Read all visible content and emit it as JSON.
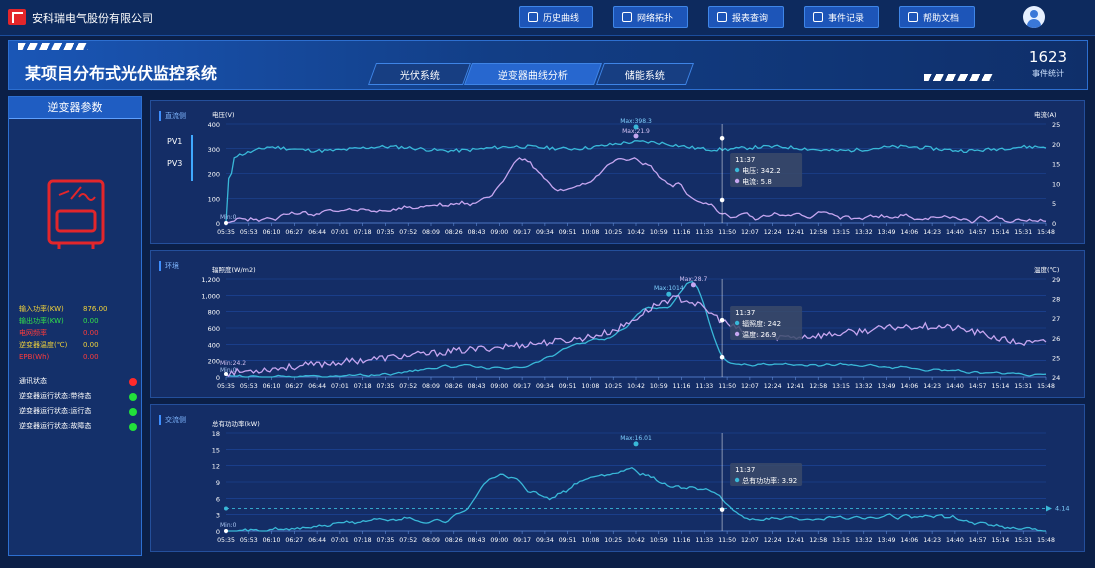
{
  "company": "安科瑞电气股份有限公司",
  "nav": [
    {
      "label": "历史曲线",
      "icon": "history-icon"
    },
    {
      "label": "网络拓扑",
      "icon": "topology-icon"
    },
    {
      "label": "报表查询",
      "icon": "search-icon"
    },
    {
      "label": "事件记录",
      "icon": "event-icon"
    },
    {
      "label": "帮助文档",
      "icon": "help-icon"
    }
  ],
  "title": "某项目分布式光伏监控系统",
  "tabs": [
    "光伏系统",
    "逆变器曲线分析",
    "储能系统"
  ],
  "event_count": "1623",
  "event_label": "事件统计",
  "left": {
    "header": "逆变器参数",
    "params": [
      {
        "k": "输入功率(KW)",
        "v": "876.00",
        "color": "#f2d33a"
      },
      {
        "k": "输出功率(KW)",
        "v": "0.00",
        "color": "#33e04a"
      },
      {
        "k": "电网频率",
        "v": "0.00",
        "color": "#ff3b3b"
      },
      {
        "k": "逆变器温度(℃)",
        "v": "0.00",
        "color": "#f2d33a"
      },
      {
        "k": "EPB(Wh)",
        "v": "0.00",
        "color": "#ff3b3b"
      }
    ],
    "status": [
      {
        "k": "通讯状态",
        "color": "#ff2a2a"
      },
      {
        "k": "逆变器运行状态:带待态",
        "color": "#22e03a"
      },
      {
        "k": "逆变器运行状态:运行态",
        "color": "#22e03a"
      },
      {
        "k": "逆变器运行状态:故障态",
        "color": "#22e03a"
      }
    ]
  },
  "time_labels": [
    "05:35",
    "05:53",
    "06:10",
    "06:27",
    "06:44",
    "07:01",
    "07:18",
    "07:35",
    "07:52",
    "08:09",
    "08:26",
    "08:43",
    "09:00",
    "09:17",
    "09:34",
    "09:51",
    "10:08",
    "10:25",
    "10:42",
    "10:59",
    "11:16",
    "11:33",
    "11:50",
    "12:07",
    "12:24",
    "12:41",
    "12:58",
    "13:15",
    "13:32",
    "13:49",
    "14:06",
    "14:23",
    "14:40",
    "14:57",
    "15:14",
    "15:31",
    "15:48"
  ],
  "charts": {
    "dc": {
      "tag": "直流侧",
      "pv_labels": [
        "PV1",
        "PV3"
      ],
      "y_left_label": "电压(V)",
      "y_right_label": "电流(A)",
      "y_left_ticks": [
        "0",
        "100",
        "200",
        "300",
        "400"
      ],
      "y_right_ticks": [
        "0",
        "5",
        "10",
        "15",
        "20",
        "25"
      ],
      "max_labels": [
        "Max:398.3",
        "Max:21.9"
      ],
      "min_label": "Min:0",
      "tooltip": {
        "time": "11:37",
        "rows": [
          "电压: 342.2",
          "电流: 5.8"
        ]
      }
    },
    "env": {
      "tag": "环境",
      "y_left_label": "辐照度(W/m2)",
      "y_right_label": "温度(℃)",
      "y_left_ticks": [
        "0",
        "200",
        "400",
        "600",
        "800",
        "1,000",
        "1,200"
      ],
      "y_right_ticks": [
        "24",
        "25",
        "26",
        "27",
        "28",
        "29"
      ],
      "max_labels": [
        "Max:1014",
        "Max:28.7"
      ],
      "min_labels": [
        "Min:24.2",
        "Min:0"
      ],
      "tooltip": {
        "time": "11:37",
        "rows": [
          "辐照度: 242",
          "温度: 26.9"
        ]
      }
    },
    "ac": {
      "tag": "交流侧",
      "y_left_label": "总有功功率(kW)",
      "y_left_ticks": [
        "0",
        "3",
        "6",
        "9",
        "12",
        "15",
        "18"
      ],
      "max_label": "Max:16.01",
      "min_label": "Min:0",
      "avg_label": "4.14",
      "tooltip": {
        "time": "11:37",
        "rows": [
          "总有功功率: 3.92"
        ]
      }
    }
  },
  "colors": {
    "cyan": "#39b8d8",
    "lavender": "#c6a6f0",
    "accent": "#2767cf"
  }
}
